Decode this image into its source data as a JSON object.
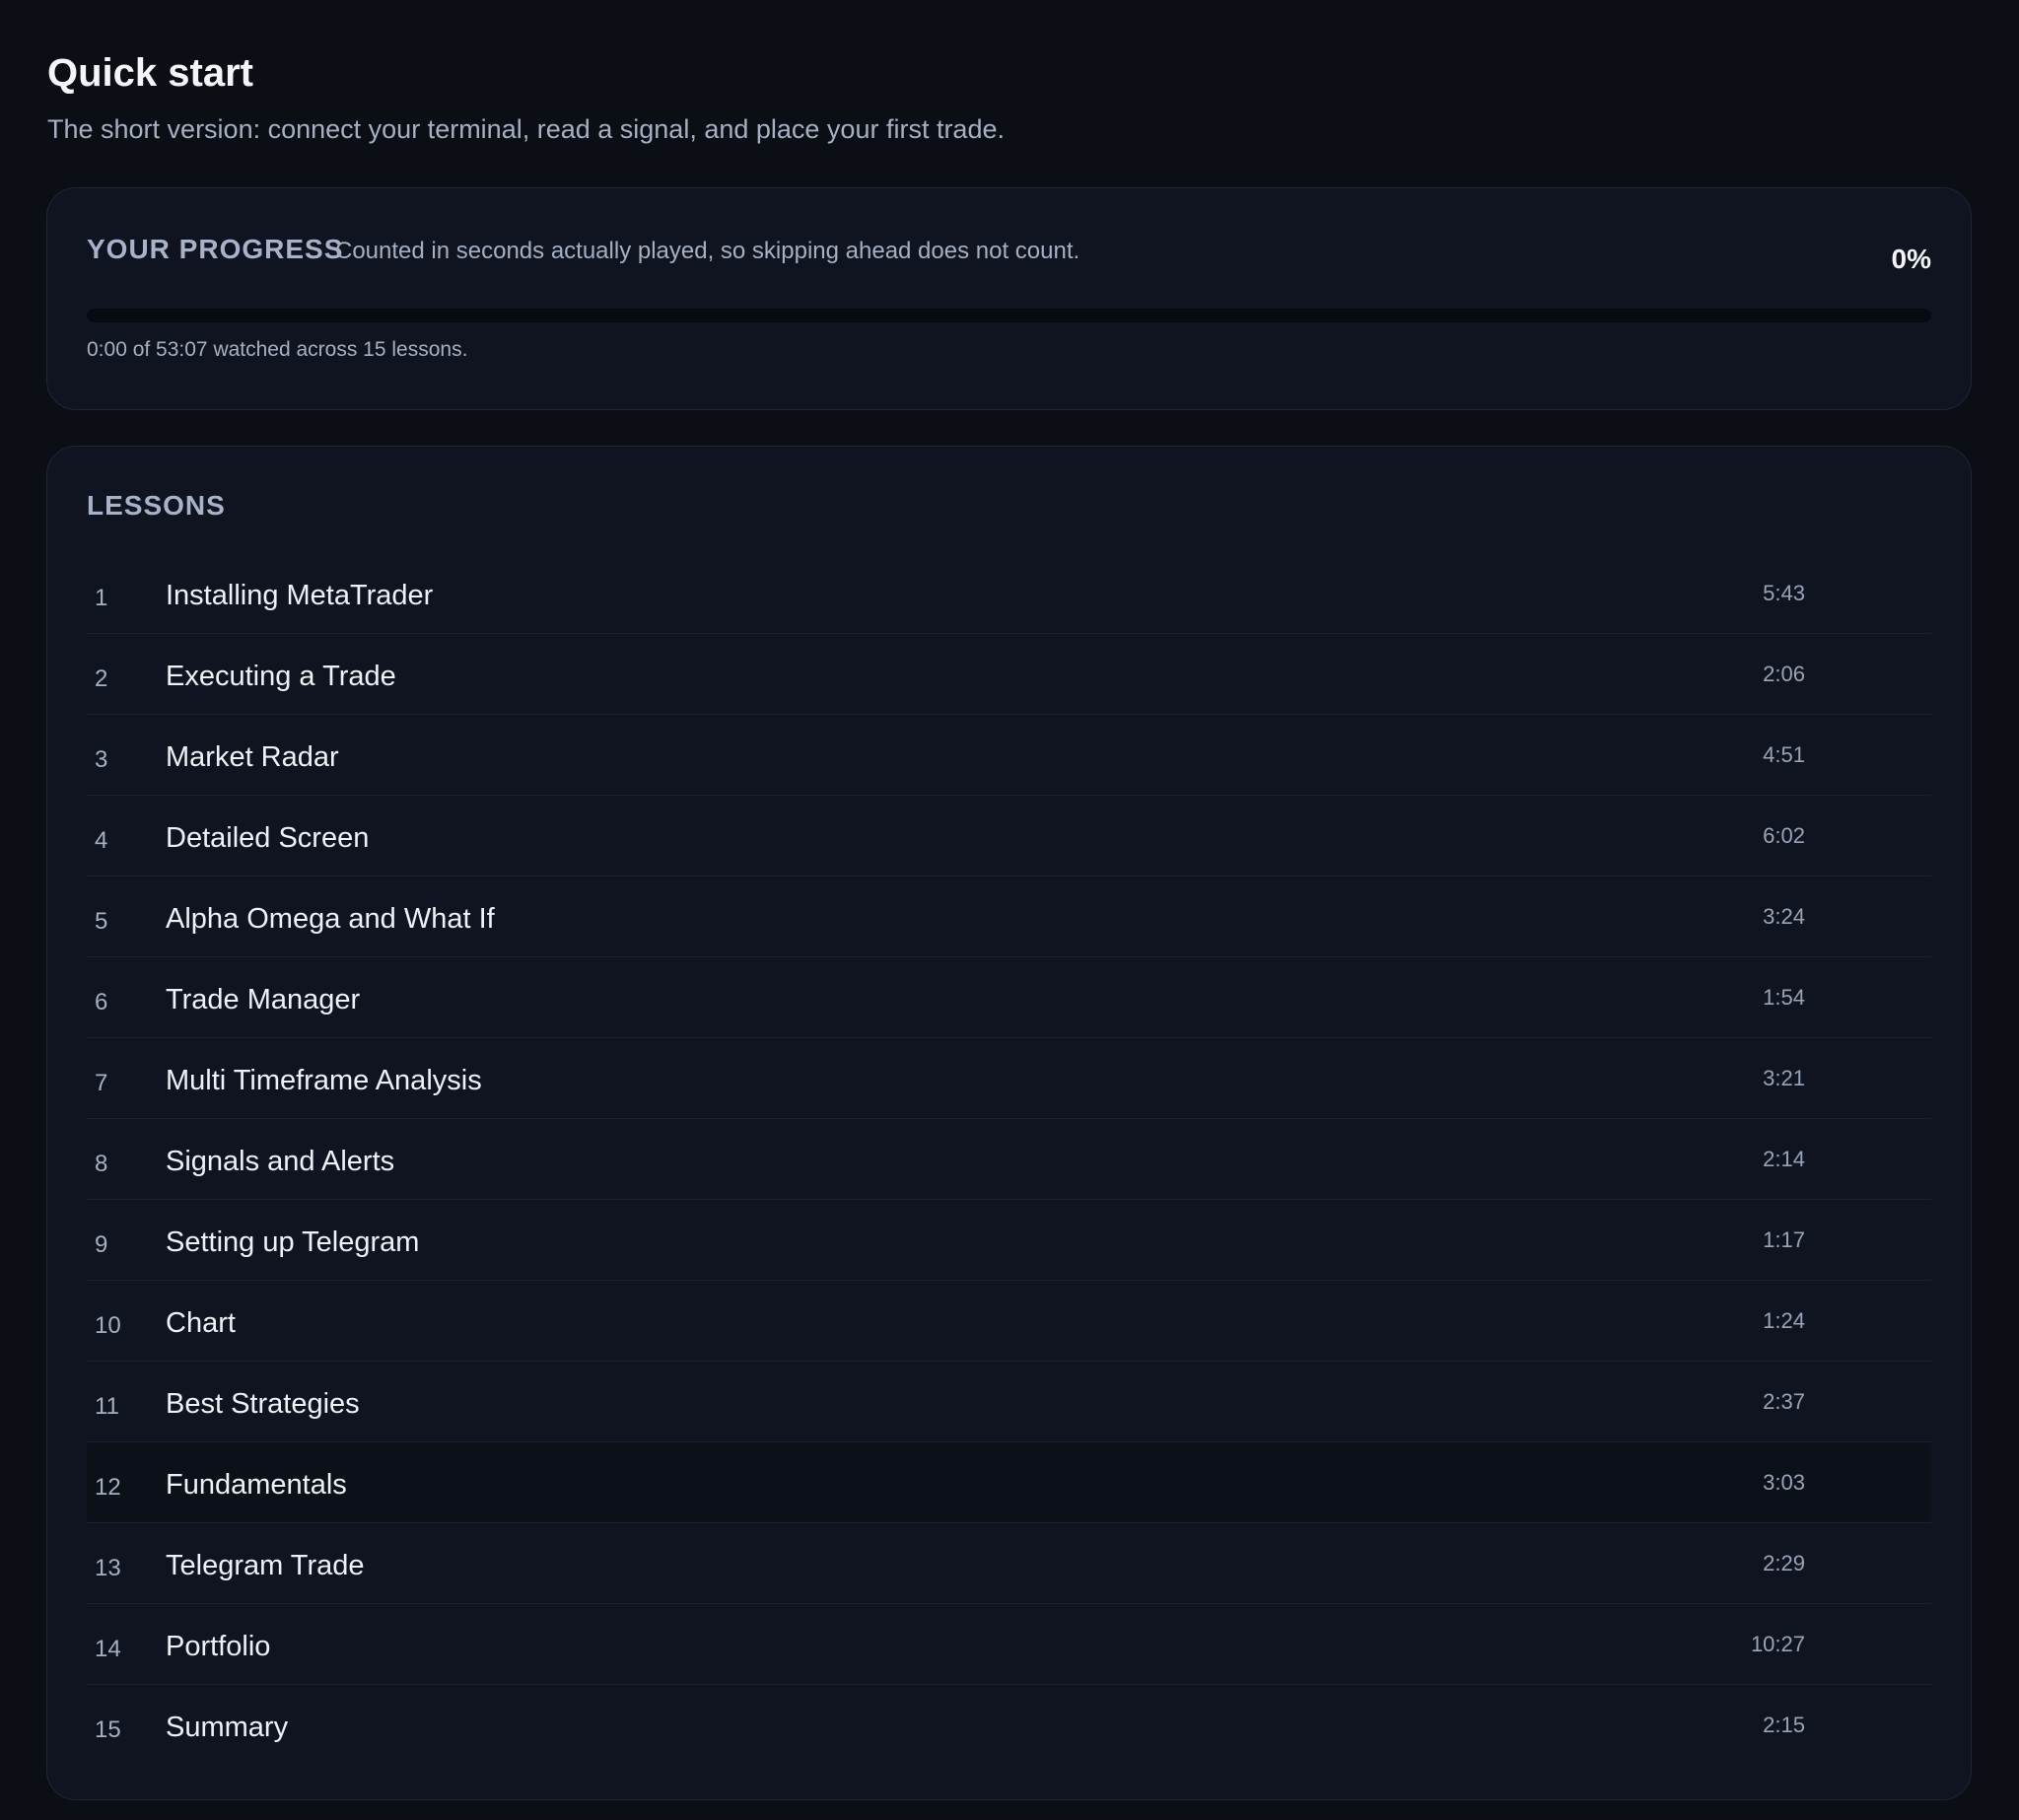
{
  "header": {
    "title": "Quick start",
    "subtitle": "The short version: connect your terminal, read a signal, and place your first trade."
  },
  "progress": {
    "label": "YOUR PROGRESS",
    "note": "Counted in seconds actually played, so skipping ahead does not count.",
    "percent_text": "0%",
    "fill_fraction": 0,
    "caption": "0:00 of 53:07 watched across 15 lessons."
  },
  "lessons": {
    "label": "LESSONS",
    "items": [
      {
        "num": "1",
        "title": "Installing MetaTrader",
        "duration": "5:43"
      },
      {
        "num": "2",
        "title": "Executing a Trade",
        "duration": "2:06"
      },
      {
        "num": "3",
        "title": "Market Radar",
        "duration": "4:51"
      },
      {
        "num": "4",
        "title": "Detailed Screen",
        "duration": "6:02"
      },
      {
        "num": "5",
        "title": "Alpha Omega and What If",
        "duration": "3:24"
      },
      {
        "num": "6",
        "title": "Trade Manager",
        "duration": "1:54"
      },
      {
        "num": "7",
        "title": "Multi Timeframe Analysis",
        "duration": "3:21"
      },
      {
        "num": "8",
        "title": "Signals and Alerts",
        "duration": "2:14"
      },
      {
        "num": "9",
        "title": "Setting up Telegram",
        "duration": "1:17"
      },
      {
        "num": "10",
        "title": "Chart",
        "duration": "1:24"
      },
      {
        "num": "11",
        "title": "Best Strategies",
        "duration": "2:37"
      },
      {
        "num": "12",
        "title": "Fundamentals",
        "duration": "3:03"
      },
      {
        "num": "13",
        "title": "Telegram Trade",
        "duration": "2:29"
      },
      {
        "num": "14",
        "title": "Portfolio",
        "duration": "10:27"
      },
      {
        "num": "15",
        "title": "Summary",
        "duration": "2:15"
      }
    ]
  },
  "colors": {
    "background": "#0b0e15",
    "card": "#0f1420",
    "accent": "#3b82f6",
    "muted_text": "#a6b0c3"
  }
}
